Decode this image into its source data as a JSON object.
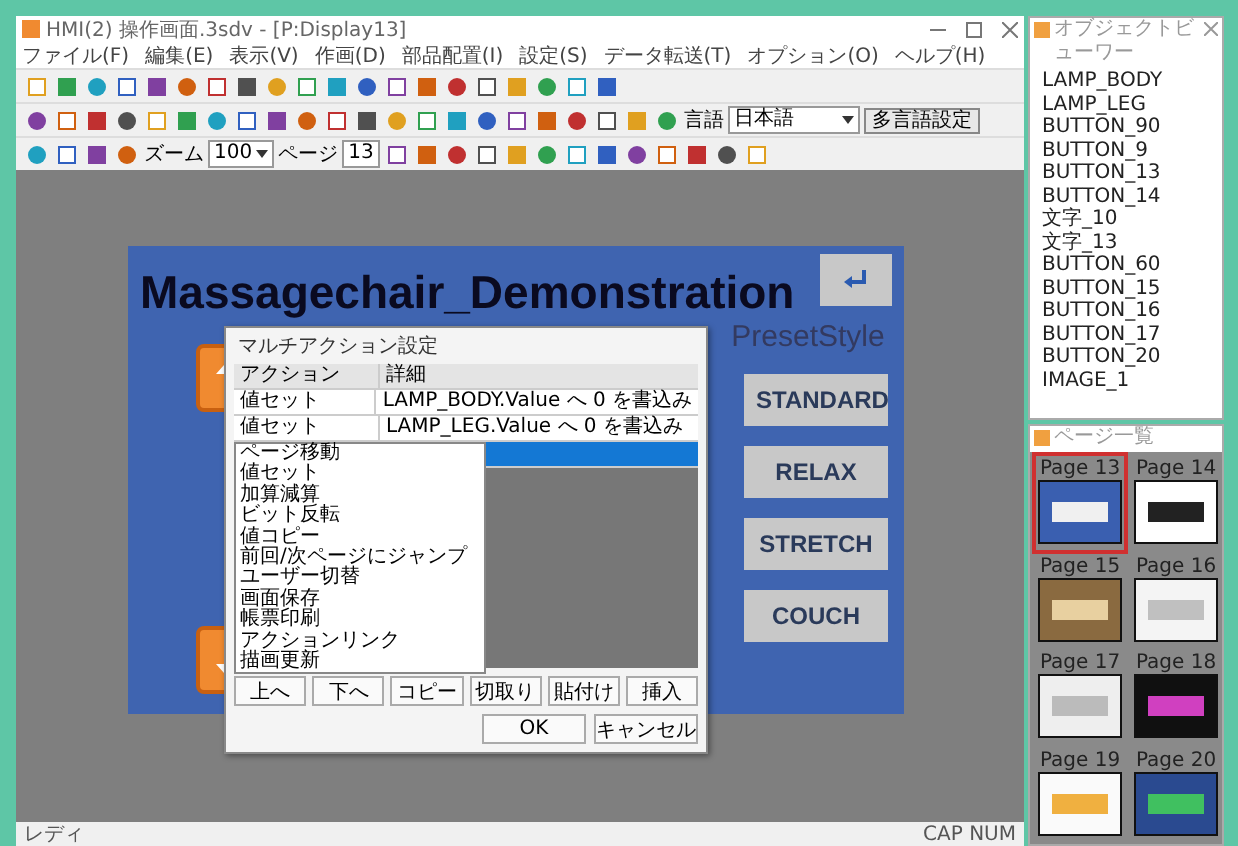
{
  "window": {
    "title": "HMI(2) 操作画面.3sdv - [P:Display13]"
  },
  "menu": [
    "ファイル(F)",
    "編集(E)",
    "表示(V)",
    "作画(D)",
    "部品配置(I)",
    "設定(S)",
    "データ転送(T)",
    "オプション(O)",
    "ヘルプ(H)"
  ],
  "toolbar": {
    "language_label": "言語",
    "language_value": "日本語",
    "language_button": "多言語設定",
    "zoom_label": "ズーム",
    "zoom_value": "100",
    "page_label": "ページ",
    "page_value": "13"
  },
  "screen": {
    "title": "Massagechair_Demonstration",
    "preset_label": "PresetStyle",
    "preset_buttons": [
      "STANDARD",
      "RELAX",
      "STRETCH",
      "COUCH"
    ]
  },
  "dialog": {
    "title": "マルチアクション設定",
    "columns": [
      "アクション",
      "詳細"
    ],
    "rows": [
      {
        "action": "値セット",
        "detail": "LAMP_BODY.Value へ 0 を書込み",
        "selected": false
      },
      {
        "action": "値セット",
        "detail": "LAMP_LEG.Value へ 0 を書込み",
        "selected": false
      }
    ],
    "editing_row": {
      "selected": true
    },
    "dropdown_options": [
      "ページ移動",
      "値セット",
      "加算減算",
      "ビット反転",
      "値コピー",
      "前回/次ページにジャンプ",
      "ユーザー切替",
      "画面保存",
      "帳票印刷",
      "アクションリンク",
      "描画更新"
    ],
    "buttons": [
      "上へ",
      "下へ",
      "コピー",
      "切取り",
      "貼付け",
      "挿入"
    ],
    "ok": "OK",
    "cancel": "キャンセル"
  },
  "object_viewer": {
    "title": "オブジェクトビューワー",
    "items": [
      "LAMP_BODY",
      "LAMP_LEG",
      "BUTTON_90",
      "BUTTON_9",
      "BUTTON_13",
      "BUTTON_14",
      "文字_10",
      "文字_13",
      "BUTTON_60",
      "BUTTON_15",
      "BUTTON_16",
      "BUTTON_17",
      "BUTTON_20",
      "IMAGE_1"
    ]
  },
  "page_list": {
    "title": "ページ一覧",
    "pages": [
      {
        "label": "Page 13",
        "selected": true,
        "kind": "panel"
      },
      {
        "label": "Page 14",
        "selected": false,
        "kind": "keypad"
      },
      {
        "label": "Page 15",
        "selected": false,
        "kind": "photo"
      },
      {
        "label": "Page 16",
        "selected": false,
        "kind": "form"
      },
      {
        "label": "Page 17",
        "selected": false,
        "kind": "grid"
      },
      {
        "label": "Page 18",
        "selected": false,
        "kind": "chart"
      },
      {
        "label": "Page 19",
        "selected": false,
        "kind": "table"
      },
      {
        "label": "Page 20",
        "selected": false,
        "kind": "dashboard"
      }
    ]
  },
  "status_bar": {
    "left": "レディ",
    "right": "CAP NUM"
  }
}
